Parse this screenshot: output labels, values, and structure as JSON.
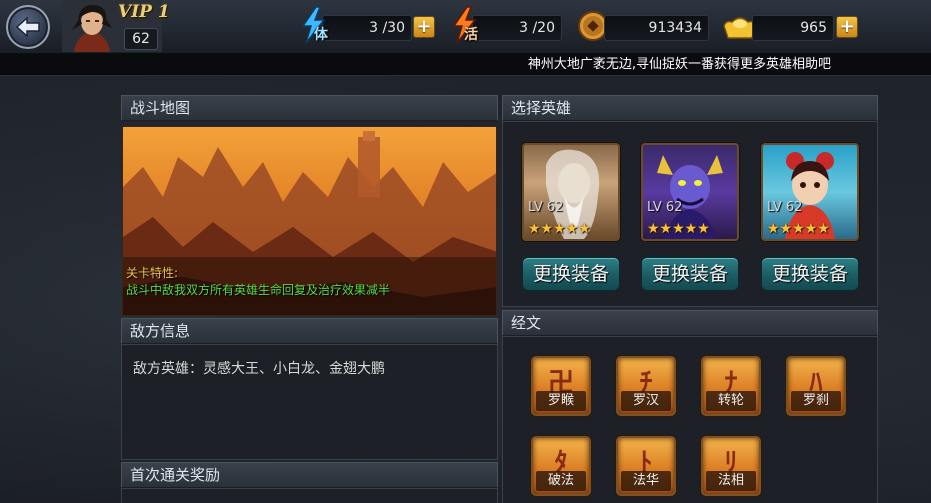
{
  "player": {
    "vip": "VIP 1",
    "level": "62"
  },
  "resources": {
    "stamina": {
      "label": "体",
      "value": "3 /30",
      "icon": "lightning-icon"
    },
    "vitality": {
      "label": "活",
      "value": "3 /20",
      "icon": "flame-icon"
    },
    "coins": {
      "value": "913434",
      "icon": "coin-icon"
    },
    "ingots": {
      "value": "965",
      "icon": "gold-ingot-icon"
    }
  },
  "ticker": {
    "text": "神州大地广袤无边,寻仙捉妖一番获得更多英雄相助吧"
  },
  "battle_map": {
    "title": "战斗地图",
    "feature_title": "关卡特性:",
    "feature_text": "战斗中敌我双方所有英雄生命回复及治疗效果减半"
  },
  "enemy_info": {
    "title": "敌方信息",
    "text": "敌方英雄：灵感大王、小白龙、金翅大鹏"
  },
  "first_clear": {
    "title": "首次通关奖励"
  },
  "select_hero": {
    "title": "选择英雄",
    "heroes": [
      {
        "level": "LV 62",
        "stars": "★★★★★",
        "stars_count": 5,
        "button": "更换装备"
      },
      {
        "level": "LV 62",
        "stars": "★★★★★",
        "stars_count": 5,
        "button": "更换装备"
      },
      {
        "level": "LV 62",
        "stars": "★★★★★",
        "stars_count": 5,
        "button": "更换装备"
      }
    ]
  },
  "scriptures": {
    "title": "经文",
    "items": [
      {
        "label": "罗睺",
        "glyph": "卍"
      },
      {
        "label": "罗汉",
        "glyph": "ﾁ"
      },
      {
        "label": "转轮",
        "glyph": "ﾅ"
      },
      {
        "label": "罗刹",
        "glyph": "ﾊ"
      },
      {
        "label": "破法",
        "glyph": "ﾀ"
      },
      {
        "label": "法华",
        "glyph": "ﾄ"
      },
      {
        "label": "法相",
        "glyph": "ﾘ"
      }
    ]
  },
  "colors": {
    "accent_gold": "#f0c44a",
    "feature_green": "#57d84a",
    "equip_button": "#1b5c63"
  }
}
